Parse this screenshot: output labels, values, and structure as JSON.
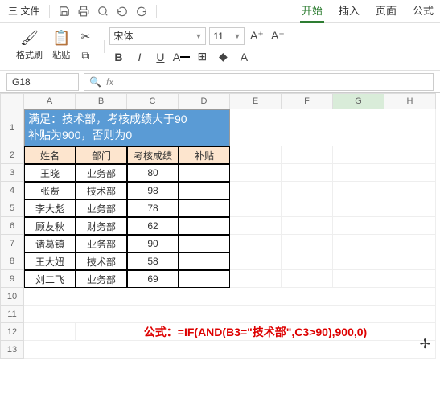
{
  "titlebar": {
    "menu": "三 文件",
    "tabs": [
      "开始",
      "插入",
      "页面",
      "公式"
    ],
    "active_tab": 0
  },
  "ribbon": {
    "format_painter": "格式刷",
    "paste": "粘贴",
    "font_name": "宋体",
    "font_size": "11",
    "buttons": {
      "bold": "B",
      "italic": "I",
      "underline": "U"
    }
  },
  "name_box": "G18",
  "fx_label": "fx",
  "col_headers": [
    "A",
    "B",
    "C",
    "D",
    "E",
    "F",
    "G",
    "H"
  ],
  "row_headers": [
    "1",
    "2",
    "3",
    "4",
    "5",
    "6",
    "7",
    "8",
    "9",
    "10",
    "11",
    "12",
    "13"
  ],
  "merged_title": {
    "line1": "满足：技术部，考核成绩大于90",
    "line2": "补贴为900，否则为0"
  },
  "table": {
    "headers": [
      "姓名",
      "部门",
      "考核成绩",
      "补贴"
    ],
    "rows": [
      {
        "name": "王晓",
        "dept": "业务部",
        "score": "80",
        "allow": ""
      },
      {
        "name": "张费",
        "dept": "技术部",
        "score": "98",
        "allow": ""
      },
      {
        "name": "李大彪",
        "dept": "业务部",
        "score": "78",
        "allow": ""
      },
      {
        "name": "顾友秋",
        "dept": "财务部",
        "score": "62",
        "allow": ""
      },
      {
        "name": "诸葛镇",
        "dept": "业务部",
        "score": "90",
        "allow": ""
      },
      {
        "name": "王大妞",
        "dept": "技术部",
        "score": "58",
        "allow": ""
      },
      {
        "name": "刘二飞",
        "dept": "业务部",
        "score": "69",
        "allow": ""
      }
    ]
  },
  "formula_text": "公式：=IF(AND(B3=\"技术部\",C3>90),900,0)"
}
